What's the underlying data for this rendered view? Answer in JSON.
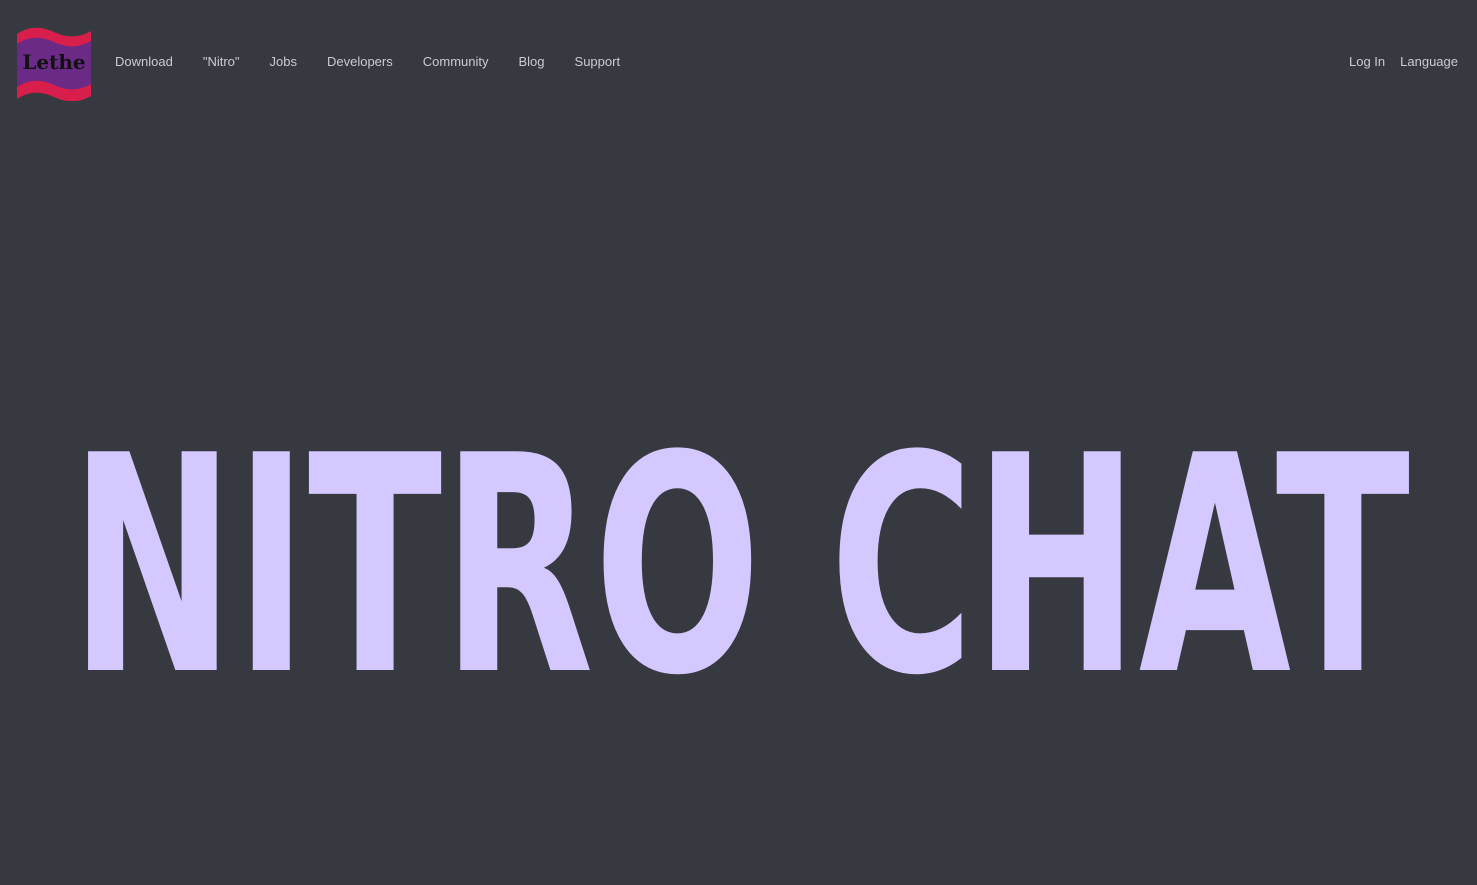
{
  "brand": {
    "logo_text": "Lethe",
    "logo_colors": {
      "stripe": "#d81e4a",
      "field": "#6a2a86",
      "text": "#111111"
    }
  },
  "nav": {
    "left": [
      "Download",
      "\"Nitro\"",
      "Jobs",
      "Developers",
      "Community",
      "Blog",
      "Support"
    ],
    "right": [
      "Log In",
      "Language"
    ]
  },
  "hero": {
    "title": "NITRO CHAT",
    "color": "#d4c8ff"
  },
  "colors": {
    "background": "#36393f",
    "nav_text": "#c9ccd1"
  }
}
